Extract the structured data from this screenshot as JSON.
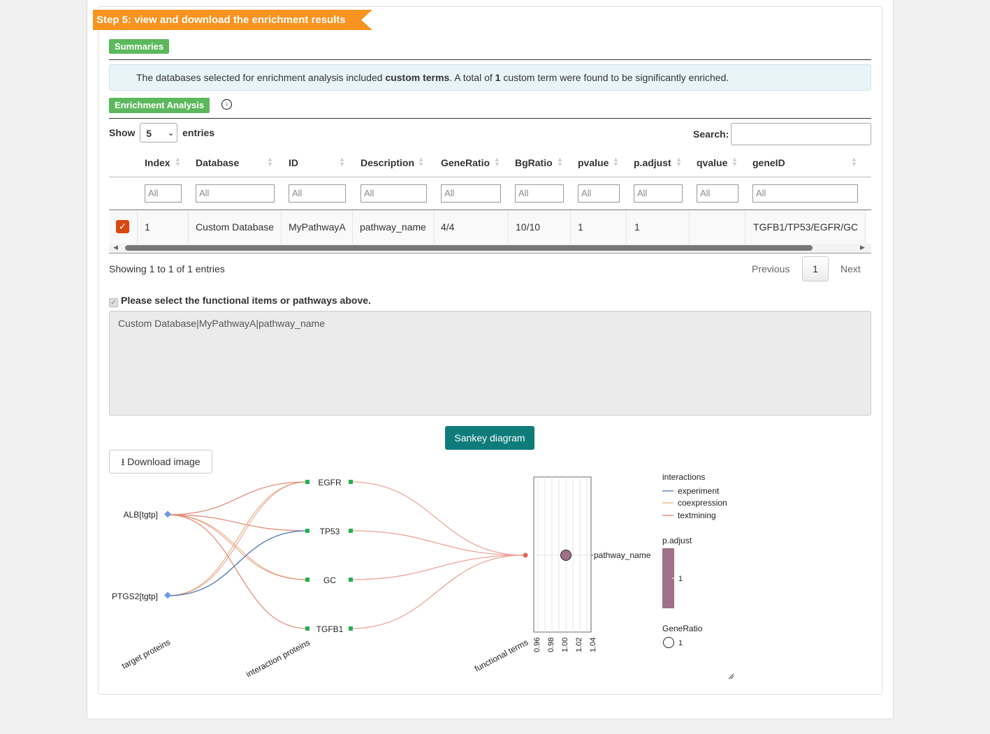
{
  "step_title": "Step 5: view and download the enrichment results",
  "summaries_label": "Summaries",
  "summary": {
    "p1": "The databases selected for enrichment analysis included ",
    "bold1": "custom terms",
    "p2": ". A total of ",
    "bold2": "1",
    "p3": " custom term were found to be significantly enriched."
  },
  "enrichment_label": "Enrichment Analysis",
  "download_icon": "download-circle-icon",
  "table": {
    "show_label": "Show",
    "entries_value": "5",
    "entries_label": "entries",
    "search_label": "Search:",
    "columns": [
      "Index",
      "Database",
      "ID",
      "Description",
      "GeneRatio",
      "BgRatio",
      "pvalue",
      "p.adjust",
      "qvalue",
      "geneID"
    ],
    "filter_placeholder": "All",
    "rows": [
      {
        "index": "1",
        "database": "Custom Database",
        "id": "MyPathwayA",
        "description": "pathway_name",
        "gene_ratio": "4/4",
        "bg_ratio": "10/10",
        "pvalue": "1",
        "padjust": "1",
        "qvalue": "",
        "gene_id": "TGFB1/TP53/EGFR/GC",
        "checked": true
      }
    ],
    "showing_text": "Showing 1 to 1 of 1 entries",
    "previous": "Previous",
    "page": "1",
    "next": "Next"
  },
  "selection_label": "Please select the functional items or pathways above.",
  "selection_text": "Custom Database|MyPathwayA|pathway_name",
  "sankey_button": "Sankey diagram",
  "download_image_button": "Download image",
  "plot": {
    "target_proteins": [
      "ALB[tgtp]",
      "PTGS2[tgtp]"
    ],
    "interaction_proteins": [
      "EGFR",
      "TP53",
      "GC",
      "TGFB1"
    ],
    "functional_term": "pathway_name",
    "axis_labels": {
      "target": "target proteins",
      "interaction": "interaction proteins",
      "functional": "functional terms"
    },
    "x_ticks": [
      "0.96",
      "0.98",
      "1.00",
      "1.02",
      "1.04"
    ],
    "dot_x": 1.0,
    "legend": {
      "interactions_title": "interactions",
      "interactions": [
        {
          "name": "experiment",
          "color": "#4a74b4"
        },
        {
          "name": "coexpression",
          "color": "#e8b07a"
        },
        {
          "name": "textmining",
          "color": "#e07a6a"
        }
      ],
      "padjust_title": "p.adjust",
      "padjust_value": "1",
      "gene_ratio_title": "GeneRatio",
      "gene_ratio_value": "1"
    },
    "colors": {
      "node_green": "#22b24c",
      "node_blue": "#6a9be0",
      "dot_fill": "#a07088",
      "term_dot": "#e06a5a"
    }
  }
}
